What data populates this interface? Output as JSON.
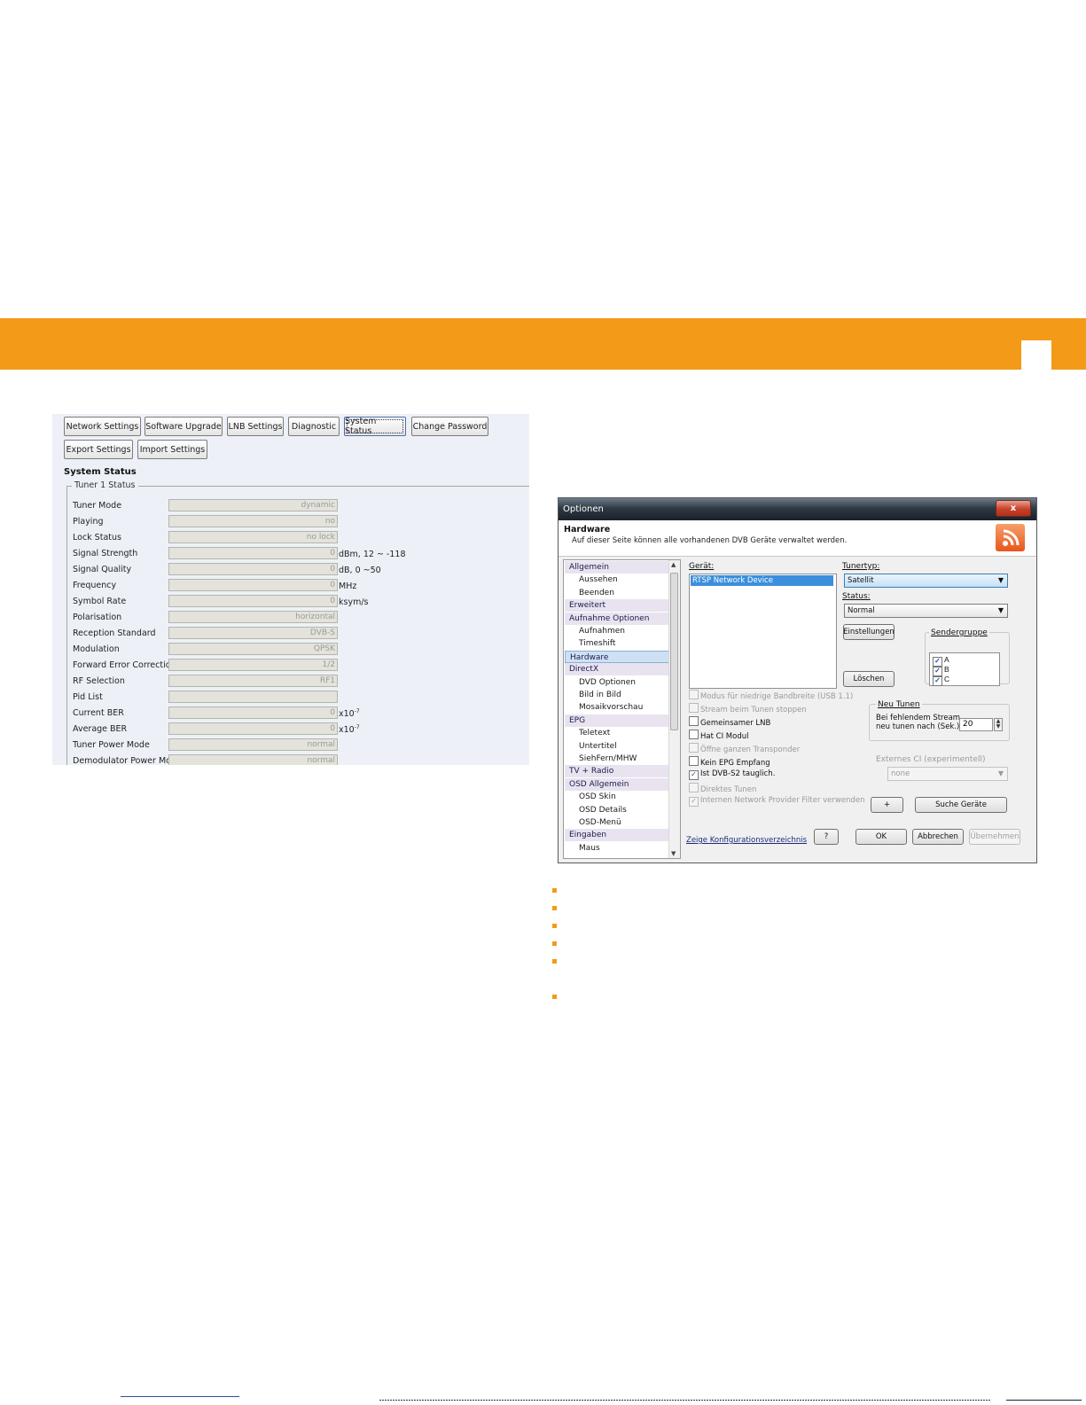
{
  "system_status_panel": {
    "buttons_row1": [
      "Network Settings",
      "Software Upgrade",
      "LNB Settings",
      "Diagnostic",
      "System Status",
      "Change Password"
    ],
    "buttons_row2": [
      "Export Settings",
      "Import Settings"
    ],
    "active_button": "System Status",
    "heading": "System Status",
    "group_label": "Tuner 1 Status",
    "rows": [
      {
        "label": "Tuner Mode",
        "value": "dynamic",
        "unit": ""
      },
      {
        "label": "Playing",
        "value": "no",
        "unit": ""
      },
      {
        "label": "Lock Status",
        "value": "no lock",
        "unit": ""
      },
      {
        "label": "Signal Strength",
        "value": "0",
        "unit": "dBm, 12 ~ -118"
      },
      {
        "label": "Signal Quality",
        "value": "0",
        "unit": "dB, 0 ~50"
      },
      {
        "label": "Frequency",
        "value": "0",
        "unit": "MHz"
      },
      {
        "label": "Symbol Rate",
        "value": "0",
        "unit": "ksym/s"
      },
      {
        "label": "Polarisation",
        "value": "horizontal",
        "unit": ""
      },
      {
        "label": "Reception Standard",
        "value": "DVB-S",
        "unit": ""
      },
      {
        "label": "Modulation",
        "value": "QPSK",
        "unit": ""
      },
      {
        "label": "Forward Error Correction",
        "value": "1/2",
        "unit": ""
      },
      {
        "label": "RF Selection",
        "value": "RF1",
        "unit": ""
      },
      {
        "label": "Pid List",
        "value": "",
        "unit": ""
      },
      {
        "label": "Current BER",
        "value": "0",
        "unit": "x10",
        "unit_sup": "-7"
      },
      {
        "label": "Average BER",
        "value": "0",
        "unit": "x10",
        "unit_sup": "-7"
      },
      {
        "label": "Tuner Power Mode",
        "value": "normal",
        "unit": ""
      },
      {
        "label": "Demodulator Power Mode",
        "value": "normal",
        "unit": ""
      }
    ]
  },
  "options_dialog": {
    "window_title": "Optionen",
    "close_label": "x",
    "header_title": "Hardware",
    "header_subtitle": "Auf dieser Seite können alle vorhandenen DVB Geräte verwaltet werden.",
    "nav": [
      {
        "label": "Allgemein",
        "level": "cat"
      },
      {
        "label": "Aussehen",
        "level": "sub"
      },
      {
        "label": "Beenden",
        "level": "sub"
      },
      {
        "label": "Erweitert",
        "level": "cat"
      },
      {
        "label": "Aufnahme Optionen",
        "level": "cat"
      },
      {
        "label": "Aufnahmen",
        "level": "sub"
      },
      {
        "label": "Timeshift",
        "level": "sub"
      },
      {
        "label": "Hardware",
        "level": "cat",
        "selected": true
      },
      {
        "label": "DirectX",
        "level": "cat"
      },
      {
        "label": "DVD Optionen",
        "level": "sub"
      },
      {
        "label": "Bild in Bild",
        "level": "sub"
      },
      {
        "label": "Mosaikvorschau",
        "level": "sub"
      },
      {
        "label": "EPG",
        "level": "cat"
      },
      {
        "label": "Teletext",
        "level": "sub"
      },
      {
        "label": "Untertitel",
        "level": "sub"
      },
      {
        "label": "SiehFern/MHW",
        "level": "sub"
      },
      {
        "label": "TV + Radio",
        "level": "cat"
      },
      {
        "label": "OSD Allgemein",
        "level": "cat"
      },
      {
        "label": "OSD Skin",
        "level": "sub"
      },
      {
        "label": "OSD Details",
        "level": "sub"
      },
      {
        "label": "OSD-Menü",
        "level": "sub"
      },
      {
        "label": "Eingaben",
        "level": "cat"
      },
      {
        "label": "Maus",
        "level": "sub"
      }
    ],
    "device_label": "Gerät:",
    "device_selected": "RTSP Network Device",
    "tunertyp_label": "Tunertyp:",
    "tunertyp_value": "Satellit",
    "status_label": "Status:",
    "status_value": "Normal",
    "einstellungen_button": "Einstellungen",
    "loeschen_button": "Löschen",
    "sendergruppe_label": "Sendergruppe",
    "sendergruppe_items": [
      "A",
      "B",
      "C"
    ],
    "checkboxes": [
      {
        "label": "Modus für niedrige Bandbreite (USB 1.1)",
        "checked": false,
        "enabled": false
      },
      {
        "label": "Stream beim Tunen stoppen",
        "checked": false,
        "enabled": false
      },
      {
        "label": "Gemeinsamer LNB",
        "checked": false,
        "enabled": true
      },
      {
        "label": "Hat CI Modul",
        "checked": false,
        "enabled": true
      },
      {
        "label": "Öffne ganzen Transponder",
        "checked": false,
        "enabled": false
      },
      {
        "label": "Kein EPG Empfang",
        "checked": false,
        "enabled": true
      },
      {
        "label": "Ist DVB-S2 tauglich.",
        "checked": true,
        "enabled": true
      },
      {
        "label": "Direktes Tunen",
        "checked": false,
        "enabled": false
      },
      {
        "label": "Internen Network Provider Filter verwenden",
        "checked": true,
        "enabled": false
      }
    ],
    "neu_tunen_label": "Neu Tunen",
    "neu_tunen_text1": "Bei fehlendem Stream",
    "neu_tunen_text2": "neu tunen nach (Sek.)",
    "neu_tunen_value": "20",
    "externes_ci_label": "Externes CI (experimentell)",
    "externes_ci_value": "none",
    "plus_button": "+",
    "suche_button": "Suche Geräte",
    "config_link": "Zeige Konfigurationsverzeichnis",
    "help_button": "?",
    "ok_button": "OK",
    "abbrechen_button": "Abbrechen",
    "uebernehmen_button": "Übernehmen"
  },
  "colors": {
    "accent_orange": "#f39a18",
    "selection_blue": "#3b8fdc"
  }
}
